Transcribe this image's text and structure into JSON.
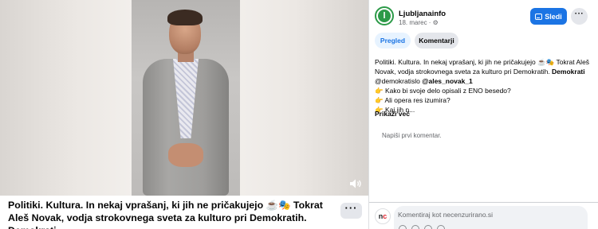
{
  "post": {
    "caption": "Politiki. Kultura. In nekaj vprašanj, ki jih ne pričakujejo ☕🎭 Tokrat Aleš Novak, vodja strokovnega sveta za kulturo pri Demokratih. Demokrati...",
    "more_label": "···",
    "video": {
      "mute_icon": "speaker-icon"
    }
  },
  "page": {
    "name": "Ljubljanainfo",
    "avatar_letter": "l",
    "date": "18. marec · ⚙",
    "follow_label": "Sledi",
    "more_label": "···",
    "accent": "#1b74e4",
    "brand": "#2c9a48"
  },
  "tabs": [
    {
      "label": "Pregled",
      "active": true
    },
    {
      "label": "Komentarji",
      "active": false
    }
  ],
  "description": {
    "line1": "Politiki. Kultura. In nekaj vprašanj, ki jih ne pričakujejo ☕🎭 Tokrat Aleš",
    "line2_text": "Novak, vodja strokovnega sveta za kulturo pri Demokratih. ",
    "line2_bold": "Demokrati",
    "line3_text": "@demokratislo ",
    "line3_bold": "@ales_novak_1",
    "q1": "👉 Kako bi svoje delo opisali z ENO besedo?",
    "q2": "👉 Ali opera res izumira?",
    "q3": "👉 Kaj jih n...",
    "show_more": "Prikaži več"
  },
  "comments": {
    "empty_text": "Napiši prvi komentar.",
    "input_placeholder": "Komentiraj kot necenzurirano.si",
    "user_avatar": {
      "prefix": "n",
      "suffix": "c"
    }
  }
}
